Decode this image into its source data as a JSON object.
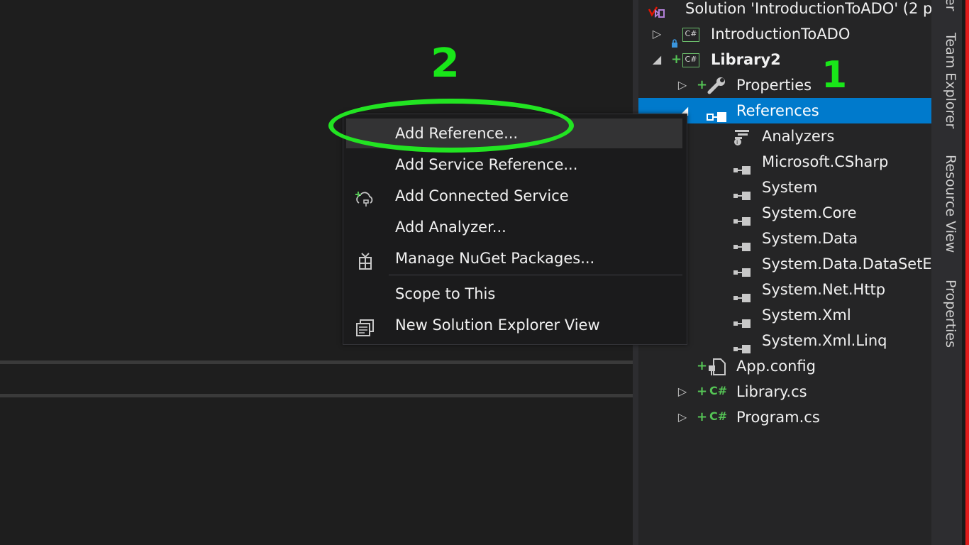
{
  "solution_explorer": {
    "items": [
      {
        "label": "Solution 'IntroductionToADO' (2 p",
        "level": 0
      },
      {
        "label": "IntroductionToADO",
        "level": 1
      },
      {
        "label": "Library2",
        "level": 1
      },
      {
        "label": "Properties",
        "level": 2
      },
      {
        "label": "References",
        "level": 2,
        "selected": true
      },
      {
        "label": "Analyzers",
        "level": 3
      },
      {
        "label": "Microsoft.CSharp",
        "level": 3
      },
      {
        "label": "System",
        "level": 3
      },
      {
        "label": "System.Core",
        "level": 3
      },
      {
        "label": "System.Data",
        "level": 3
      },
      {
        "label": "System.Data.DataSetEx",
        "level": 3
      },
      {
        "label": "System.Net.Http",
        "level": 3
      },
      {
        "label": "System.Xml",
        "level": 3
      },
      {
        "label": "System.Xml.Linq",
        "level": 3
      },
      {
        "label": "App.config",
        "level": 2
      },
      {
        "label": "Library.cs",
        "level": 2
      },
      {
        "label": "Program.cs",
        "level": 2
      }
    ],
    "csharp_badge": "C#"
  },
  "side_tabs": [
    "Team Explorer",
    "Resource View",
    "Properties"
  ],
  "side_tab_top_fragment": "er",
  "context_menu": {
    "items": [
      {
        "label": "Add Reference...",
        "icon": null
      },
      {
        "label": "Add Service Reference...",
        "icon": null
      },
      {
        "label": "Add Connected Service",
        "icon": "connected-service-icon"
      },
      {
        "label": "Add Analyzer...",
        "icon": null
      },
      {
        "label": "Manage NuGet Packages...",
        "icon": "nuget-icon"
      },
      {
        "label": "Scope to This",
        "icon": null
      },
      {
        "label": "New Solution Explorer View",
        "icon": "new-view-icon"
      }
    ]
  },
  "annotations": {
    "step1": "1",
    "step2": "2"
  },
  "colors": {
    "selection": "#007acc",
    "annotation": "#22e422",
    "background": "#1e1e1e",
    "panel": "#252526"
  }
}
